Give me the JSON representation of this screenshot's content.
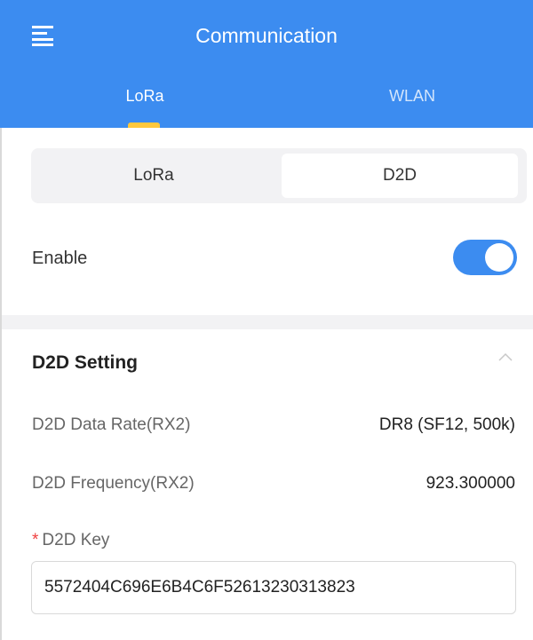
{
  "header": {
    "title": "Communication",
    "menu_icon": "hamburger-menu-icon",
    "tabs": [
      {
        "label": "LoRa",
        "active": true
      },
      {
        "label": "WLAN",
        "active": false
      }
    ]
  },
  "segmented": {
    "options": [
      {
        "label": "LoRa",
        "selected": false
      },
      {
        "label": "D2D",
        "selected": true
      }
    ]
  },
  "enable": {
    "label": "Enable",
    "value": true
  },
  "d2d_setting": {
    "title": "D2D Setting",
    "collapse_icon": "chevron-up-icon",
    "fields": [
      {
        "label": "D2D Data Rate(RX2)",
        "value": "DR8 (SF12, 500k)"
      },
      {
        "label": "D2D Frequency(RX2)",
        "value": "923.300000"
      }
    ],
    "key": {
      "required_marker": "*",
      "label": "D2D Key",
      "value": "5572404C696E6B4C6F52613230313823"
    }
  },
  "colors": {
    "primary": "#3c8cf0",
    "tab_indicator": "#ffc83d",
    "required": "#f04040"
  }
}
